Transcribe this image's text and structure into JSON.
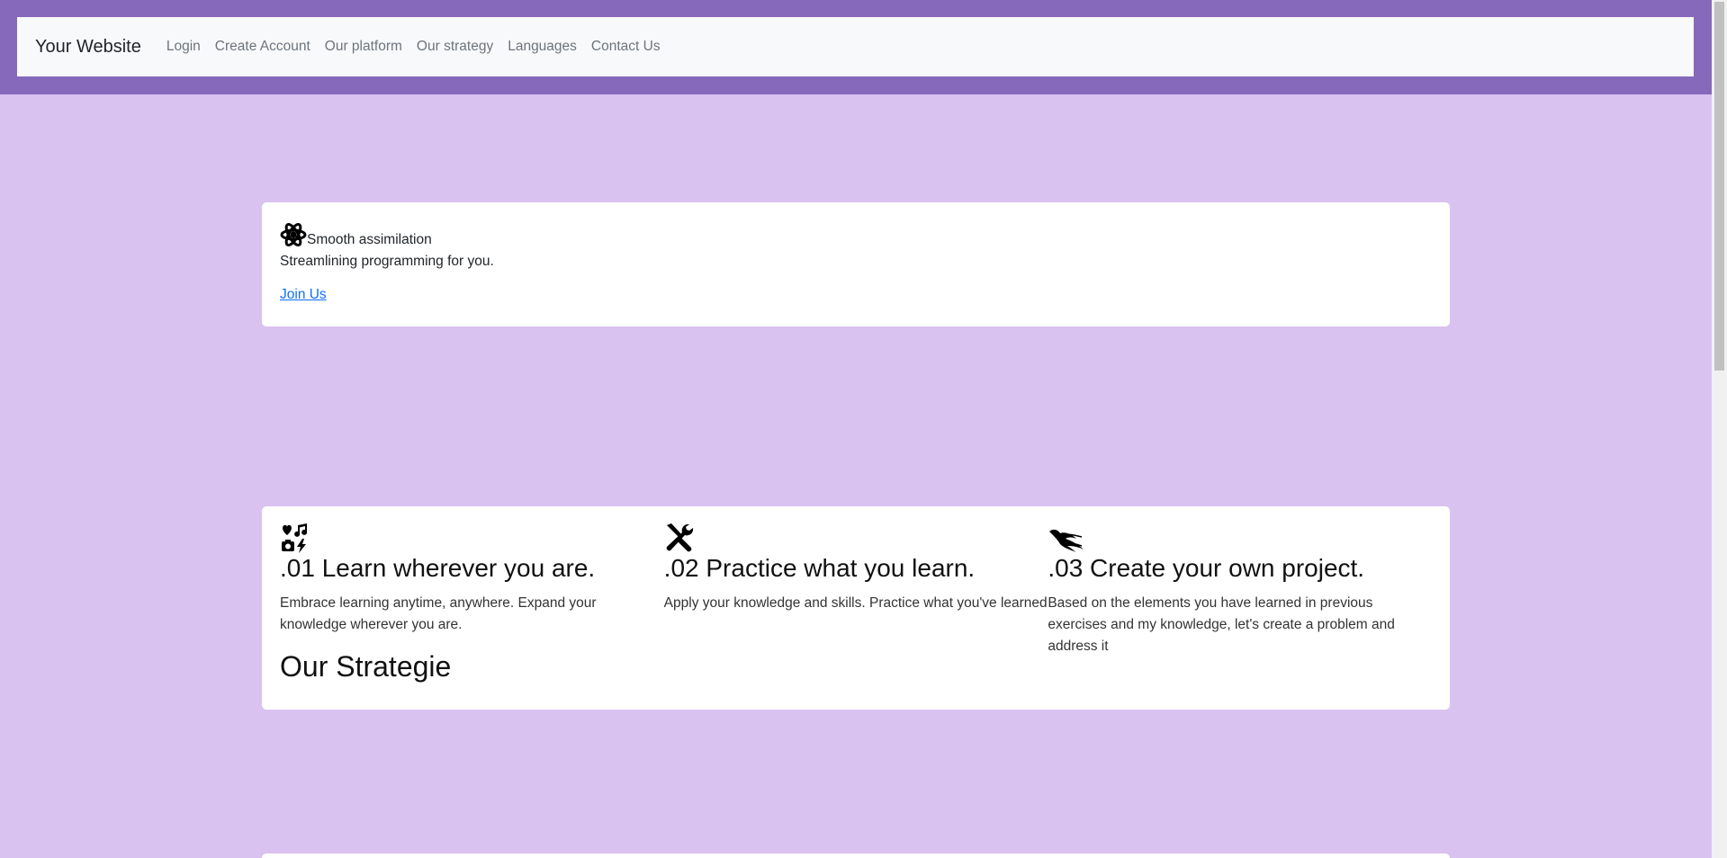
{
  "nav": {
    "brand": "Your Website",
    "links": [
      "Login",
      "Create Account",
      "Our platform",
      "Our strategy",
      "Languages",
      "Contact Us"
    ]
  },
  "hero": {
    "icon": "atom-icon",
    "title": "Smooth assimilation",
    "subtitle": "Streamlining programming for you.",
    "link": "Join Us",
    "link_color": "#0d6efd"
  },
  "features": [
    {
      "icon": "heart-music-camera-bolt-icon",
      "title": ".01 Learn wherever you are.",
      "text": "Embrace learning anytime, anywhere. Expand your knowledge wherever you are."
    },
    {
      "icon": "screwdriver-wrench-icon",
      "title": ".02 Practice what you learn.",
      "text": "Apply your knowledge and skills. Practice what you've learned"
    },
    {
      "icon": "phoenix-bird-icon",
      "title": ".03 Create your own project.",
      "text": "Based on the elements you have learned in previous exercises and my knowledge, let's create a problem and address it"
    }
  ],
  "strategy_heading": "Our Strategie",
  "colors": {
    "page_bg": "#d9c2f0",
    "header_band": "#8769bb",
    "navbar_bg": "#f8f9fa"
  }
}
